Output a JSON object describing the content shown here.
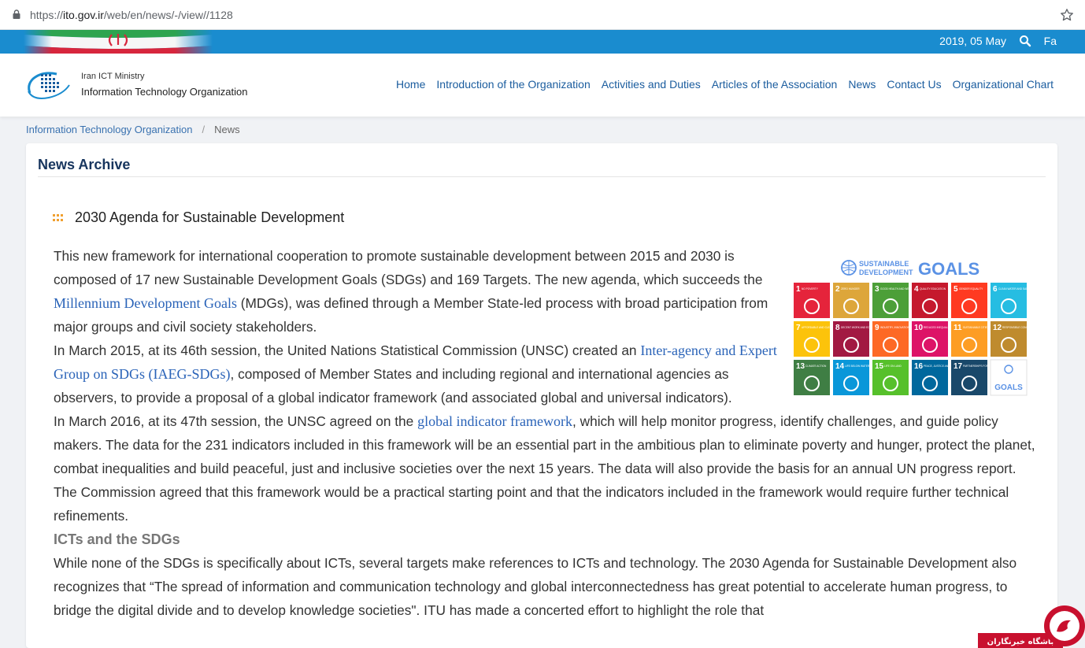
{
  "browser": {
    "url_prefix": "https://",
    "url_host": "ito.gov.ir",
    "url_path": "/web/en/news/-/view//1128"
  },
  "topbar": {
    "date": "2019, 05 May",
    "lang": "Fa",
    "bg_color": "#1a8ccf"
  },
  "header": {
    "ministry": "Iran ICT Ministry",
    "org": "Information Technology Organization"
  },
  "nav": [
    "Home",
    "Introduction of the Organization",
    "Activities and Duties",
    "Articles of the Association",
    "News",
    "Contact Us",
    "Organizational Chart"
  ],
  "breadcrumb": {
    "home": "Information Technology Organization",
    "sep": "/",
    "current": "News"
  },
  "card": {
    "title": "News Archive"
  },
  "article": {
    "title": "2030 Agenda for Sustainable Development",
    "p1_a": " This new framework for international cooperation to promote sustainable development between 2015 and 2030 is composed of 17 new Sustainable Development Goals (SDGs) and 169 Targets. The new agenda, which succeeds the ",
    "p1_link": "Millennium Development Goals",
    "p1_b": " (MDGs), was defined through a Member State-led process with broad participation from major groups and civil society stakeholders.",
    "p2_a": "In March 2015, at its 46th session, the United Nations Statistical Commission (UNSC) created an ",
    "p2_link": "Inter-agency and Expert Group on SDGs (IAEG-SDGs)",
    "p2_b": ", composed of Member States and including regional and international agencies as observers, to provide a proposal of a global indicator framework (and associated global and universal indicators).",
    "p3_a": "In March 2016, at its 47th session, the UNSC agreed on the ",
    "p3_link": "global indicator framework",
    "p3_b": ", which will help monitor progress, identify challenges, and guide policy makers. The data for the 231 indicators included in this framework will be an essential part in the ambitious plan to eliminate poverty and hunger, protect the planet, combat inequalities and build peaceful, just and inclusive societies over the next 15 years. The data will also provide the basis for an annual UN progress report. The Commission agreed that this framework would be a practical starting point and that the indicators included in the framework would require further technical refinements.",
    "h_icts": "ICTs and the SDGs",
    "p4": "While none of the SDGs is specifically about ICTs, several targets make references to ICTs and technology. The 2030 Agenda for Sustainable Development also recognizes that “The spread of information and communication technology and global interconnectedness has great potential to accelerate human progress, to bridge the digital divide and to develop knowledge societies\". ITU has made a concerted effort to highlight the role that"
  },
  "sdg_image": {
    "heading_1": "SUSTAINABLE",
    "heading_2": "DEVELOPMENT",
    "heading_goals": "GOALS",
    "tiles": [
      {
        "n": "1",
        "label": "NO POVERTY",
        "color": "#e5243b"
      },
      {
        "n": "2",
        "label": "ZERO HUNGER",
        "color": "#dda63a"
      },
      {
        "n": "3",
        "label": "GOOD HEALTH AND WELL-BEING",
        "color": "#4c9f38"
      },
      {
        "n": "4",
        "label": "QUALITY EDUCATION",
        "color": "#c5192d"
      },
      {
        "n": "5",
        "label": "GENDER EQUALITY",
        "color": "#ff3a21"
      },
      {
        "n": "6",
        "label": "CLEAN WATER AND SANITATION",
        "color": "#26bde2"
      },
      {
        "n": "7",
        "label": "AFFORDABLE AND CLEAN ENERGY",
        "color": "#fcc30b"
      },
      {
        "n": "8",
        "label": "DECENT WORK AND ECONOMIC GROWTH",
        "color": "#a21942"
      },
      {
        "n": "9",
        "label": "INDUSTRY, INNOVATION AND INFRASTRUCTURE",
        "color": "#fd6925"
      },
      {
        "n": "10",
        "label": "REDUCED INEQUALITIES",
        "color": "#dd1367"
      },
      {
        "n": "11",
        "label": "SUSTAINABLE CITIES AND COMMUNITIES",
        "color": "#fd9d24"
      },
      {
        "n": "12",
        "label": "RESPONSIBLE CONSUMPTION AND PRODUCTION",
        "color": "#bf8b2e"
      },
      {
        "n": "13",
        "label": "CLIMATE ACTION",
        "color": "#3f7e44"
      },
      {
        "n": "14",
        "label": "LIFE BELOW WATER",
        "color": "#0a97d9"
      },
      {
        "n": "15",
        "label": "LIFE ON LAND",
        "color": "#56c02b"
      },
      {
        "n": "16",
        "label": "PEACE, JUSTICE AND STRONG INSTITUTIONS",
        "color": "#00689d"
      },
      {
        "n": "17",
        "label": "PARTNERSHIPS FOR THE GOALS",
        "color": "#19486a"
      }
    ]
  },
  "watermark": {
    "text": "باشگاه خبرنگاران"
  }
}
